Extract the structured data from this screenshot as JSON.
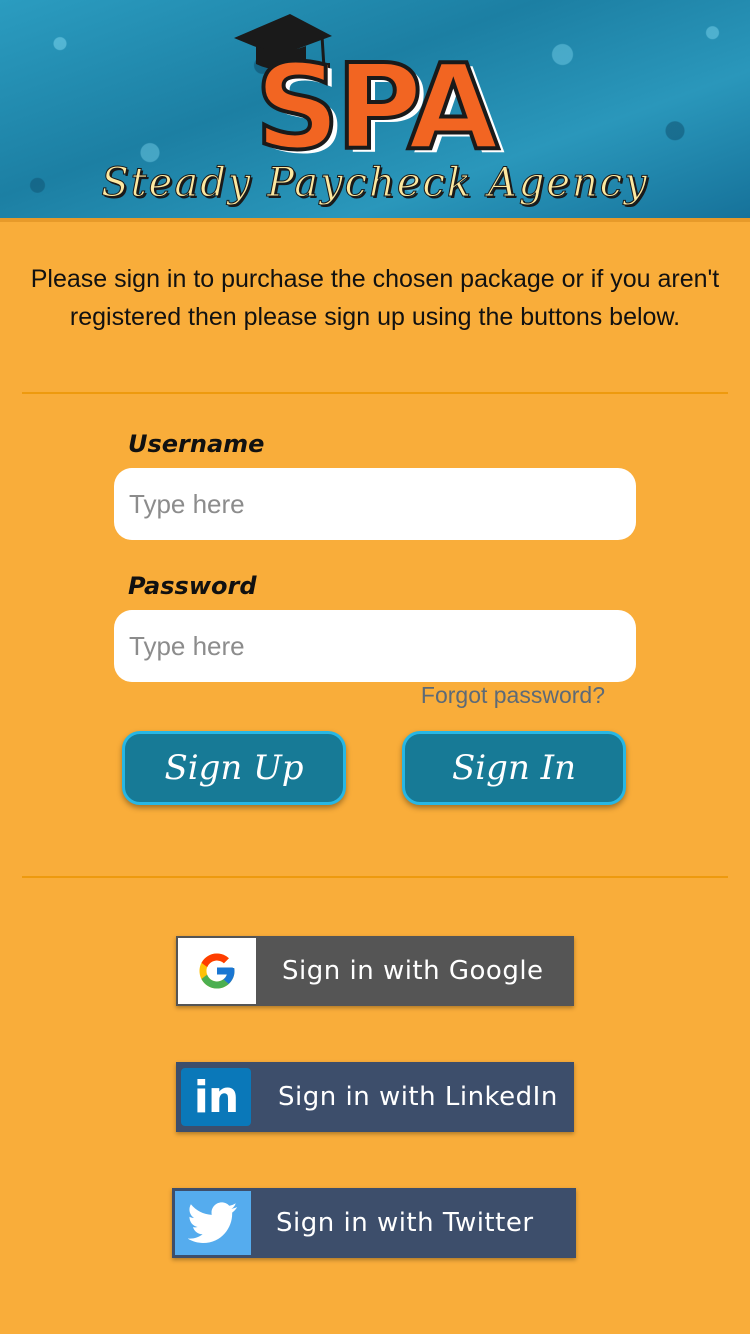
{
  "header": {
    "logo_text": "SPA",
    "tagline": "Steady Paycheck Agency"
  },
  "intro": {
    "message": "Please sign in to purchase the chosen package or if you aren't registered then please sign up using the buttons below."
  },
  "form": {
    "username_label": "Username",
    "username_placeholder": "Type here",
    "password_label": "Password",
    "password_placeholder": "Type here",
    "forgot_link": "Forgot password?",
    "signup_label": "Sign Up",
    "signin_label": "Sign In"
  },
  "social": {
    "google_label": "Sign in with Google",
    "linkedin_label": "Sign in with LinkedIn",
    "twitter_label": "Sign in with Twitter",
    "linkedin_logo_text": "in"
  },
  "colors": {
    "background": "#f9ad3a",
    "accent": "#177a96",
    "google_button": "#555555",
    "linkedin_button": "#3d4e6b",
    "twitter_button": "#3d4e6b"
  }
}
